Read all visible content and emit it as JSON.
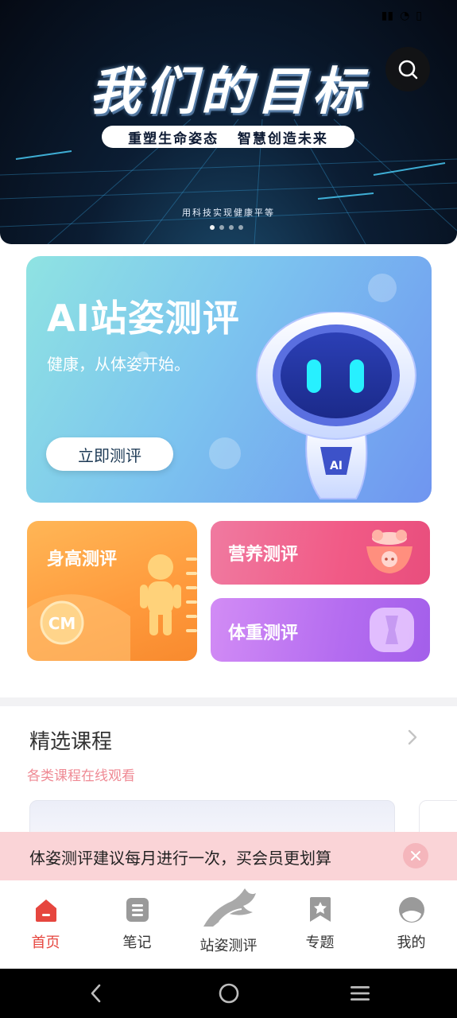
{
  "banner": {
    "title": "我们的目标",
    "pill": "重塑生命姿态   智慧创造未来",
    "subtitle": "用科技实现健康平等",
    "slide_count": 4,
    "active_slide": 1
  },
  "ai_card": {
    "title": "AI站姿测评",
    "subtitle": "健康，从体姿开始。",
    "button": "立即测评",
    "robot_badge": "AI"
  },
  "cards": {
    "height": "身高测评",
    "height_badge": "CM",
    "nutrition": "营养测评",
    "weight": "体重测评"
  },
  "courses": {
    "title": "精选课程",
    "subtitle": "各类课程在线观看"
  },
  "notice": {
    "text": "体姿测评建议每月进行一次，买会员更划算"
  },
  "tabs": [
    {
      "label": "首页",
      "icon": "home-icon",
      "active": true
    },
    {
      "label": "笔记",
      "icon": "notes-icon",
      "active": false
    },
    {
      "label": "站姿测评",
      "icon": "posture-logo-icon",
      "active": false
    },
    {
      "label": "专题",
      "icon": "bookmark-icon",
      "active": false
    },
    {
      "label": "我的",
      "icon": "profile-icon",
      "active": false
    }
  ],
  "colors": {
    "accent": "#e6463f",
    "notice_bg": "#fad4d7",
    "course_sub": "#ef8a94"
  }
}
